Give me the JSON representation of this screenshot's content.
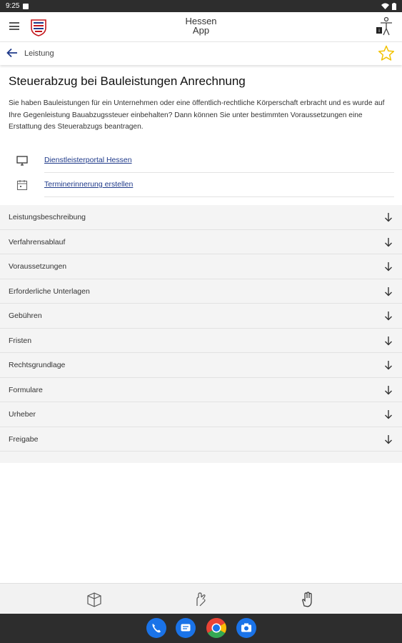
{
  "status_bar": {
    "time": "9:25"
  },
  "header": {
    "title_line1": "Hessen",
    "title_line2": "App"
  },
  "toolbar": {
    "label": "Leistung"
  },
  "content": {
    "title": "Steuerabzug bei Bauleistungen Anrechnung",
    "intro": "Sie haben Bauleistungen für ein Unternehmen oder eine öffentlich-rechtliche Körperschaft erbracht und es wurde auf Ihre Gegenleistung Bauabzugssteuer einbehalten? Dann können Sie unter bestimmten Voraussetzungen eine Erstattung des Steuerabzugs beantragen.",
    "links": [
      {
        "label": "Dienstleisterportal Hessen",
        "icon": "monitor-icon"
      },
      {
        "label": "Terminerinnerung erstellen",
        "icon": "calendar-icon"
      }
    ]
  },
  "accordion": [
    {
      "label": "Leistungsbeschreibung"
    },
    {
      "label": "Verfahrensablauf"
    },
    {
      "label": "Voraussetzungen"
    },
    {
      "label": "Erforderliche Unterlagen"
    },
    {
      "label": "Gebühren"
    },
    {
      "label": "Fristen"
    },
    {
      "label": "Rechtsgrundlage"
    },
    {
      "label": "Formulare"
    },
    {
      "label": "Urheber"
    },
    {
      "label": "Freigabe"
    }
  ],
  "bottom_tabs": [
    {
      "icon": "map-icon"
    },
    {
      "icon": "sign-language-icon"
    },
    {
      "icon": "hand-icon"
    }
  ],
  "dock": [
    {
      "icon": "phone-icon",
      "color": "#1a73e8"
    },
    {
      "icon": "messages-icon",
      "color": "#1a73e8"
    },
    {
      "icon": "chrome-icon",
      "color": "#ea4335"
    },
    {
      "icon": "camera-icon",
      "color": "#1a73e8"
    }
  ],
  "colors": {
    "accent": "#1f3a8a",
    "star": "#f2c200"
  }
}
